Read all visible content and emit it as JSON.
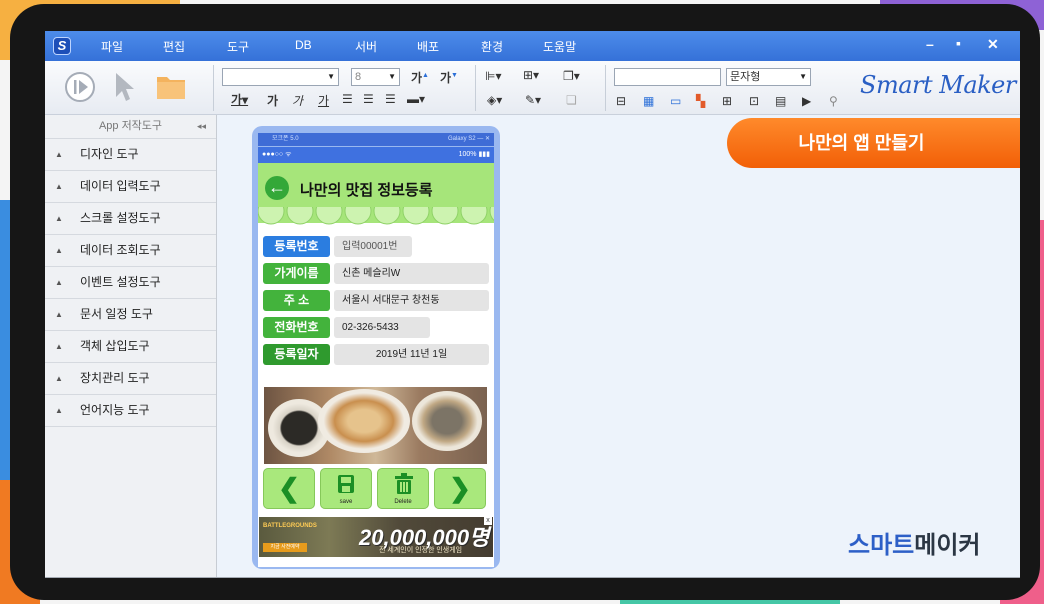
{
  "menu": {
    "logo": "S",
    "items": [
      "파일",
      "편집",
      "도구",
      "DB",
      "서버",
      "배포",
      "환경",
      "도움말"
    ],
    "window_controls": [
      "–",
      "▪",
      "✕"
    ]
  },
  "toolbar": {
    "font_size": "8",
    "text_style": "문자형",
    "bold_label": "가",
    "italic_label": "가",
    "underline_label": "가",
    "brand_logo": "Smart Maker"
  },
  "sidebar": {
    "header": "App 저작도구",
    "collapse": "◂◂",
    "items": [
      {
        "label": "디자인 도구"
      },
      {
        "label": "데이터 입력도구"
      },
      {
        "label": "스크롤 설정도구"
      },
      {
        "label": "데이터 조회도구"
      },
      {
        "label": "이벤트 설정도구"
      },
      {
        "label": "문서 일정 도구"
      },
      {
        "label": "객체 삽입도구"
      },
      {
        "label": "장치관리 도구"
      },
      {
        "label": "언어지능 도구"
      }
    ]
  },
  "banner": "나만의 앱 만들기",
  "brand": {
    "part1": "스마트",
    "part2": "메이커"
  },
  "phone": {
    "window_title": "모크폰 5.0",
    "window_right": "Galaxy S2  —  ✕",
    "status_left": "●●●○○ ᯤ",
    "status_right": "100% ▮▮▮",
    "header_title": "나만의 맛집 정보등록",
    "back_glyph": "←",
    "fields": [
      {
        "label": "등록번호",
        "value": "입력00001번",
        "color": "#2b7de0"
      },
      {
        "label": "가게이름",
        "value": "신촌 메슬리W",
        "color": "#43b33c"
      },
      {
        "label": "주      소",
        "value": "서울시 서대문구 창천동",
        "color": "#43b33c"
      },
      {
        "label": "전화번호",
        "value": "02-326-5433",
        "color": "#43b33c"
      },
      {
        "label": "등록일자",
        "value": "2019년 11년 1일",
        "color": "#2f9a2e"
      }
    ],
    "nav": {
      "prev_glyph": "❮",
      "next_glyph": "❯",
      "save_label": "save",
      "delete_label": "Delete"
    },
    "ad": {
      "game": "BATTLEGROUNDS",
      "amount": "20,000,000명",
      "tagline": "전 세계인이 인정한 인생게임",
      "button": "지금 사전예약",
      "close": "x"
    }
  },
  "colors": {
    "menubar": "#3d7ee6",
    "banner": "#f36a10",
    "brand_blue": "#2d5fc7"
  }
}
